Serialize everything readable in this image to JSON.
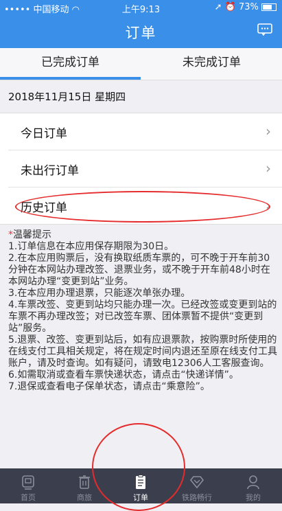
{
  "status_bar": {
    "carrier": "中国移动",
    "time": "上午9:13",
    "battery": "73%"
  },
  "header": {
    "title": "订单"
  },
  "tabs": [
    {
      "label": "已完成订单"
    },
    {
      "label": "未完成订单"
    }
  ],
  "date_line": "2018年11月15日 星期四",
  "menu": [
    {
      "label": "今日订单"
    },
    {
      "label": "未出行订单"
    },
    {
      "label": "历史订单"
    }
  ],
  "tips": {
    "heading": "温馨提示",
    "items": [
      "1.订单信息在本应用保存期限为30日。",
      "2.在本应用购票后，没有换取纸质车票的，可不晚于开车前30分钟在本网站办理改签、退票业务，或不晚于开车前48小时在本网站办理“变更到站”业务。",
      "3.在本应用办理退票，只能逐次单张办理。",
      "4.车票改签、变更到站均只能办理一次。已经改签或变更到站的车票不再办理改签；对已改签车票、团体票暂不提供“变更到站”服务。",
      "5.退票、改签、变更到站后，如有应退票款，按购票时所使用的在线支付工具相关规定，将在规定时间内退还至原在线支付工具账户，请及时查询。如有疑问，请致电12306人工客服查询。",
      "6.如需取消或查看车票快递状态，请点击“快递详情”。",
      "7.退保或查看电子保单状态，请点击“乘意险”。"
    ]
  },
  "tabbar": [
    {
      "label": "首页",
      "icon": "home-icon"
    },
    {
      "label": "商旅",
      "icon": "trash-icon"
    },
    {
      "label": "订单",
      "icon": "clipboard-icon"
    },
    {
      "label": "铁路畅行",
      "icon": "diamond-icon"
    },
    {
      "label": "我的",
      "icon": "person-icon"
    }
  ],
  "colors": {
    "accent": "#3a8fe8",
    "annotation": "#e52b2b"
  }
}
